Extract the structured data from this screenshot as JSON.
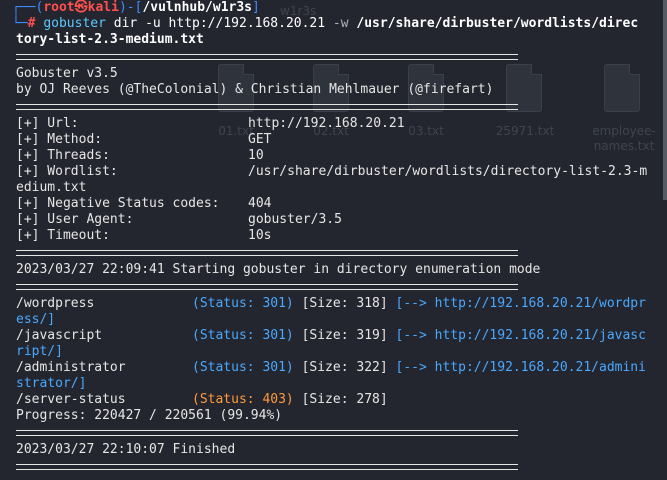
{
  "prompt": {
    "user": "root",
    "at": "㉿",
    "host": "kali",
    "path": "/vulnhub/w1r3s",
    "symbol": "#"
  },
  "command": {
    "program": "gobuster",
    "line1_rest": " dir -u http://192.168.20.21 ",
    "flag": "-w",
    "line1_path": " /usr/share/dirbuster/wordlists/direc",
    "line2": "tory-list-2.3-medium.txt"
  },
  "banner": {
    "version": "Gobuster v3.5",
    "authors": "by OJ Reeves (@TheColonial) & Christian Mehlmauer (@firefart)"
  },
  "config": [
    {
      "key": "[+] Url:",
      "value": "http://192.168.20.21"
    },
    {
      "key": "[+] Method:",
      "value": "GET"
    },
    {
      "key": "[+] Threads:",
      "value": "10"
    },
    {
      "key": "[+] Wordlist:",
      "value": "/usr/share/dirbuster/wordlists/directory-list-2.3-m"
    },
    {
      "key": "",
      "value": "edium.txt",
      "wrap": true
    },
    {
      "key": "[+] Negative Status codes:",
      "value": "404"
    },
    {
      "key": "[+] User Agent:",
      "value": "gobuster/3.5"
    },
    {
      "key": "[+] Timeout:",
      "value": "10s"
    }
  ],
  "start_msg": "2023/03/27 22:09:41 Starting gobuster in directory enumeration mode",
  "results": [
    {
      "path": "/wordpress",
      "status": "(Status: 301)",
      "size": "[Size: 318]",
      "arrow": "[-->",
      "url": "http://192.168.20.21/wordpr",
      "wrap": "ess/]"
    },
    {
      "path": "/javascript",
      "status": "(Status: 301)",
      "size": "[Size: 319]",
      "arrow": "[-->",
      "url": "http://192.168.20.21/javasc",
      "wrap": "ript/]"
    },
    {
      "path": "/administrator",
      "status": "(Status: 301)",
      "size": "[Size: 322]",
      "arrow": "[-->",
      "url": "http://192.168.20.21/admini",
      "wrap": "strator/]"
    },
    {
      "path": "/server-status",
      "status": "(Status: 403)",
      "size": "[Size: 278]",
      "arrow": "",
      "url": "",
      "wrap": ""
    }
  ],
  "progress": "Progress: 220427 / 220561 (99.94%)",
  "finish_msg": "2023/03/27 22:10:07 Finished",
  "desktop": {
    "files": [
      "01.txt",
      "02.txt",
      "03.txt",
      "25971.txt",
      "employee-names.txt"
    ],
    "top_label": "w1r3s"
  }
}
